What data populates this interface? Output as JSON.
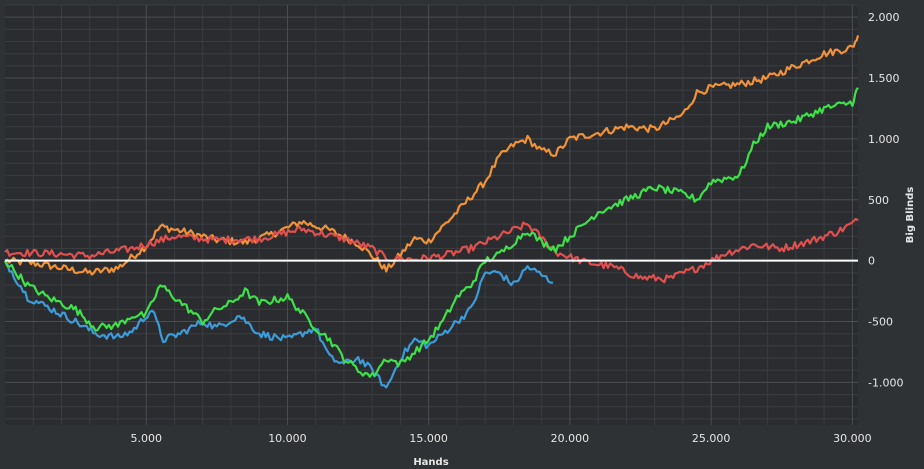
{
  "chart_data": {
    "type": "line",
    "title": "",
    "xlabel": "Hands",
    "ylabel": "Big Blinds",
    "xlim": [
      0,
      30200
    ],
    "ylim": [
      -1350,
      2100
    ],
    "x_ticks": [
      5000,
      10000,
      15000,
      20000,
      25000,
      30000
    ],
    "x_tick_labels": [
      "5.000",
      "10.000",
      "15.000",
      "20.000",
      "25.000",
      "30.000"
    ],
    "y_ticks": [
      2000,
      1500,
      1000,
      500,
      0,
      -500,
      -1000
    ],
    "y_tick_labels": [
      "2.000",
      "1.500",
      "1.000",
      "500",
      "0",
      "-500",
      "-1.000"
    ],
    "grid": true,
    "zero_line": true,
    "series": [
      {
        "color": "#f0923a",
        "x": [
          0,
          1000,
          2000,
          3000,
          4000,
          5000,
          5500,
          6500,
          7500,
          8500,
          9500,
          10500,
          11500,
          12500,
          13200,
          13500,
          14000,
          14500,
          15000,
          16000,
          17000,
          17500,
          18000,
          18500,
          19000,
          19500,
          20000,
          21000,
          22000,
          23000,
          24000,
          24500,
          25000,
          26000,
          27000,
          28000,
          29000,
          30000,
          30200
        ],
        "y": [
          0,
          -20,
          -60,
          -100,
          -60,
          120,
          280,
          230,
          170,
          150,
          220,
          320,
          250,
          140,
          0,
          -80,
          50,
          180,
          160,
          400,
          650,
          850,
          950,
          1000,
          900,
          880,
          1000,
          1050,
          1100,
          1080,
          1200,
          1380,
          1420,
          1450,
          1500,
          1600,
          1700,
          1750,
          1850
        ]
      },
      {
        "color": "#e0504f",
        "x": [
          0,
          1500,
          3000,
          4500,
          6000,
          7500,
          9000,
          10500,
          12000,
          13000,
          13500,
          14500,
          15500,
          16500,
          17500,
          18500,
          19500,
          20500,
          21500,
          22500,
          23500,
          24500,
          25500,
          26500,
          27500,
          28500,
          29500,
          30200
        ],
        "y": [
          70,
          60,
          40,
          100,
          200,
          170,
          180,
          260,
          180,
          100,
          20,
          10,
          40,
          100,
          200,
          300,
          70,
          -10,
          -50,
          -140,
          -150,
          -60,
          60,
          130,
          100,
          160,
          240,
          330
        ]
      },
      {
        "color": "#3d9bd8",
        "x": [
          0,
          800,
          1500,
          2500,
          3200,
          4000,
          4500,
          5200,
          5600,
          6200,
          7000,
          7500,
          8300,
          9000,
          10000,
          11000,
          11500,
          12000,
          12500,
          13000,
          13500,
          14000,
          14500,
          15000,
          15500,
          16000,
          16500,
          17000,
          17500,
          18000,
          18500,
          19000,
          19400
        ],
        "y": [
          0,
          -300,
          -380,
          -500,
          -600,
          -630,
          -580,
          -400,
          -650,
          -600,
          -500,
          -550,
          -450,
          -600,
          -650,
          -550,
          -800,
          -850,
          -800,
          -900,
          -1050,
          -800,
          -650,
          -700,
          -600,
          -500,
          -400,
          -100,
          -100,
          -200,
          -50,
          -120,
          -180
        ]
      },
      {
        "color": "#3fe04a",
        "x": [
          0,
          800,
          1500,
          2500,
          3200,
          4000,
          4500,
          5000,
          5500,
          6500,
          7000,
          7500,
          8000,
          8500,
          9000,
          10000,
          11000,
          11500,
          12000,
          12500,
          13000,
          13500,
          14000,
          14500,
          15000,
          15500,
          16000,
          16500,
          17000,
          17500,
          18000,
          18500,
          19000,
          19500,
          20000,
          21000,
          22000,
          23000,
          24000,
          24500,
          25000,
          26000,
          26500,
          27000,
          28000,
          29000,
          30000,
          30200
        ],
        "y": [
          0,
          -200,
          -300,
          -400,
          -550,
          -530,
          -450,
          -450,
          -200,
          -400,
          -500,
          -400,
          -350,
          -250,
          -350,
          -300,
          -550,
          -650,
          -800,
          -900,
          -950,
          -800,
          -850,
          -750,
          -650,
          -500,
          -300,
          -200,
          0,
          50,
          150,
          250,
          150,
          100,
          200,
          400,
          500,
          600,
          550,
          500,
          650,
          700,
          950,
          1100,
          1150,
          1250,
          1300,
          1420
        ]
      }
    ]
  }
}
